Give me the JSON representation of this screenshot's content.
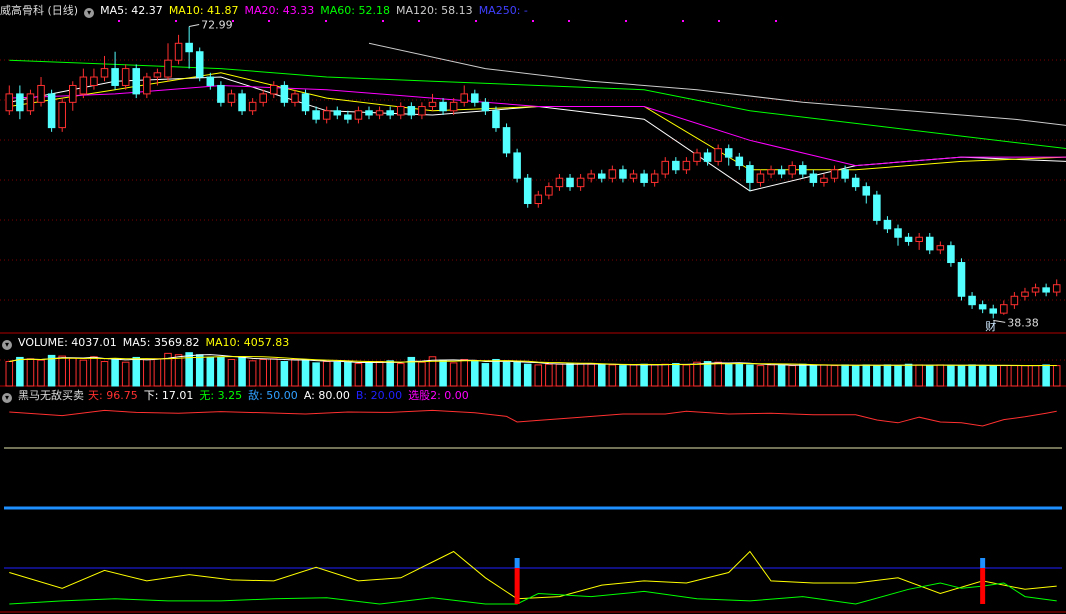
{
  "price_panel": {
    "title": "威高骨科 (日线)",
    "ma_labels": [
      {
        "text": "MA5: 42.37",
        "color": "#ffffff"
      },
      {
        "text": "MA10: 41.87",
        "color": "#ffff00"
      },
      {
        "text": "MA20: 43.33",
        "color": "#ff00ff"
      },
      {
        "text": "MA60: 52.18",
        "color": "#00ff00"
      },
      {
        "text": "MA120: 58.13",
        "color": "#cccccc"
      },
      {
        "text": "MA250: -",
        "color": "#4040ff"
      }
    ],
    "high_label": "72.99",
    "low_label": "38.38",
    "event_marker": "财"
  },
  "volume_panel": {
    "labels": [
      {
        "text": "VOLUME: 4037.01",
        "color": "#ffffff"
      },
      {
        "text": "MA5: 3569.82",
        "color": "#ffffff"
      },
      {
        "text": "MA10: 4057.83",
        "color": "#ffff00"
      }
    ]
  },
  "indicator_panel": {
    "title": "黑马无敌买卖",
    "labels": [
      {
        "text": "天: 96.75",
        "color": "#ff3030"
      },
      {
        "text": "下: 17.01",
        "color": "#ffffff"
      },
      {
        "text": "无: 3.25",
        "color": "#00ff00"
      },
      {
        "text": "敌: 50.00",
        "color": "#30a0ff"
      },
      {
        "text": "A: 80.00",
        "color": "#ffffff"
      },
      {
        "text": "B: 20.00",
        "color": "#2020ff"
      },
      {
        "text": "选股2: 0.00",
        "color": "#ff00ff"
      }
    ]
  },
  "colors": {
    "up": "#ff3030",
    "down": "#54ffff",
    "ma5": "#ffffff",
    "ma10": "#ffff00",
    "ma20": "#ff00ff",
    "ma60": "#00ff00",
    "ma120": "#cccccc",
    "frame": "#b00000",
    "grid": "#800000",
    "signal": "#ff0000"
  },
  "chart_data": [
    {
      "type": "candlestick",
      "ylim": [
        37,
        74
      ],
      "extrema": {
        "high": 72.99,
        "low": 38.38
      },
      "series": [
        {
          "name": "MA5",
          "x": [
            0,
            10,
            20,
            30,
            40,
            50,
            60,
            70,
            80,
            90,
            100,
            110,
            118
          ],
          "values": [
            64.0,
            66.5,
            67.0,
            63.0,
            62.5,
            63.5,
            62.0,
            53.5,
            56.5,
            57.5,
            57.0,
            46.5,
            41.6
          ]
        },
        {
          "name": "MA10",
          "x": [
            0,
            10,
            20,
            30,
            40,
            50,
            60,
            70,
            80,
            90,
            100,
            110,
            118
          ],
          "values": [
            63.5,
            65.5,
            67.5,
            64.5,
            63.0,
            63.5,
            63.5,
            56.0,
            56.0,
            57.0,
            57.5,
            48.5,
            41.9
          ]
        },
        {
          "name": "MA20",
          "x": [
            0,
            10,
            20,
            30,
            40,
            50,
            60,
            70,
            80,
            90,
            100,
            110,
            118
          ],
          "values": [
            64.5,
            65.0,
            66.0,
            65.5,
            64.5,
            63.5,
            63.5,
            59.5,
            56.5,
            57.5,
            57.5,
            53.5,
            43.3
          ]
        },
        {
          "name": "MA60",
          "x": [
            0,
            10,
            20,
            30,
            40,
            50,
            60,
            70,
            80,
            90,
            100,
            110,
            118
          ],
          "values": [
            69.0,
            68.5,
            68.0,
            67.0,
            66.5,
            66.0,
            65.5,
            63.0,
            61.5,
            60.0,
            58.5,
            55.5,
            52.2
          ]
        },
        {
          "name": "MA120",
          "x": [
            34,
            45,
            55,
            65,
            75,
            85,
            95,
            105,
            118
          ],
          "values": [
            71.0,
            68.0,
            66.5,
            65.5,
            64.0,
            63.0,
            62.0,
            60.5,
            58.1
          ]
        }
      ],
      "candles": [
        [
          0,
          63,
          65,
          62.5,
          66
        ],
        [
          1,
          65,
          63,
          62,
          66
        ],
        [
          2,
          63,
          65,
          62.5,
          65.5
        ],
        [
          3,
          64,
          66,
          63.5,
          67
        ],
        [
          4,
          65,
          61,
          60.5,
          65.5
        ],
        [
          5,
          61,
          64,
          60.5,
          64.5
        ],
        [
          6,
          64,
          66,
          63,
          66.5
        ],
        [
          7,
          65,
          67,
          64.5,
          68
        ],
        [
          8,
          66,
          67,
          65.5,
          68
        ],
        [
          9,
          67,
          68,
          66.5,
          69.5
        ],
        [
          10,
          68,
          66,
          65.5,
          70
        ],
        [
          11,
          66,
          68,
          65.5,
          68.5
        ],
        [
          12,
          68,
          65,
          64.5,
          68.5
        ],
        [
          13,
          65,
          67,
          64.5,
          67.5
        ],
        [
          14,
          67,
          67.5,
          66,
          68
        ],
        [
          15,
          67,
          69,
          66.5,
          71
        ],
        [
          16,
          69,
          71,
          68.5,
          72
        ],
        [
          17,
          71,
          70,
          68,
          72.99
        ],
        [
          18,
          70,
          67,
          66.5,
          70.5
        ],
        [
          19,
          67,
          66,
          65.5,
          67.5
        ],
        [
          20,
          66,
          64,
          63.5,
          66.5
        ],
        [
          21,
          64,
          65,
          63.5,
          65.5
        ],
        [
          22,
          65,
          63,
          62.5,
          65.5
        ],
        [
          23,
          63,
          64,
          62.5,
          64.5
        ],
        [
          24,
          64,
          65,
          63.5,
          65.5
        ],
        [
          25,
          65,
          66,
          64.5,
          66.5
        ],
        [
          26,
          66,
          64,
          63.5,
          66.5
        ],
        [
          27,
          64,
          65,
          63.5,
          65.5
        ],
        [
          28,
          65,
          63,
          62.5,
          65.5
        ],
        [
          29,
          63,
          62,
          61.5,
          63.5
        ],
        [
          30,
          62,
          63,
          61.5,
          63.5
        ],
        [
          31,
          63,
          62.5,
          62,
          63.5
        ],
        [
          32,
          62.5,
          62,
          61.5,
          63
        ],
        [
          33,
          62,
          63,
          61.5,
          63.5
        ],
        [
          34,
          63,
          62.5,
          62,
          63.5
        ],
        [
          35,
          62.5,
          63,
          62,
          63.5
        ],
        [
          36,
          63,
          62.5,
          62,
          63.5
        ],
        [
          37,
          62.5,
          63.5,
          62,
          64
        ],
        [
          38,
          63.5,
          62.5,
          62,
          64
        ],
        [
          39,
          62.5,
          63.5,
          62,
          64
        ],
        [
          40,
          63.5,
          64,
          63,
          65
        ],
        [
          41,
          64,
          63,
          62.5,
          64.5
        ],
        [
          42,
          63,
          64,
          62.5,
          64.5
        ],
        [
          43,
          64,
          65,
          63.5,
          66
        ],
        [
          44,
          65,
          64,
          63.5,
          65.5
        ],
        [
          45,
          64,
          63,
          62.5,
          64.5
        ],
        [
          46,
          63,
          61,
          60.5,
          63.5
        ],
        [
          47,
          61,
          58,
          57.5,
          61.5
        ],
        [
          48,
          58,
          55,
          54.5,
          58.5
        ],
        [
          49,
          55,
          52,
          51.5,
          55.5
        ],
        [
          50,
          52,
          53,
          51.5,
          53.5
        ],
        [
          51,
          53,
          54,
          52.5,
          54.5
        ],
        [
          52,
          54,
          55,
          53.5,
          55.5
        ],
        [
          53,
          55,
          54,
          53.5,
          55.5
        ],
        [
          54,
          54,
          55,
          53.5,
          55.5
        ],
        [
          55,
          55,
          55.5,
          54.5,
          56
        ],
        [
          56,
          55.5,
          55,
          54.5,
          56
        ],
        [
          57,
          55,
          56,
          54.5,
          56.5
        ],
        [
          58,
          56,
          55,
          54.5,
          56.5
        ],
        [
          59,
          55,
          55.5,
          54.5,
          56
        ],
        [
          60,
          55.5,
          54.5,
          54,
          56
        ],
        [
          61,
          54.5,
          55.5,
          54,
          56
        ],
        [
          62,
          55.5,
          57,
          55,
          57.5
        ],
        [
          63,
          57,
          56,
          55.5,
          57.5
        ],
        [
          64,
          56,
          57,
          55.5,
          57.5
        ],
        [
          65,
          57,
          58,
          56.5,
          58.5
        ],
        [
          66,
          58,
          57,
          56.5,
          58.5
        ],
        [
          67,
          57,
          58.5,
          56.5,
          59
        ],
        [
          68,
          58.5,
          57.5,
          56.5,
          59
        ],
        [
          69,
          57.5,
          56.5,
          56,
          58
        ],
        [
          70,
          56.5,
          54.5,
          53.5,
          57
        ],
        [
          71,
          54.5,
          55.5,
          54,
          56
        ],
        [
          72,
          55.5,
          56,
          55,
          56.5
        ],
        [
          73,
          56,
          55.5,
          55,
          56.5
        ],
        [
          74,
          55.5,
          56.5,
          55,
          57
        ],
        [
          75,
          56.5,
          55.5,
          55,
          57
        ],
        [
          76,
          55.5,
          54.5,
          54,
          56
        ],
        [
          77,
          54.5,
          55,
          54,
          55.5
        ],
        [
          78,
          55,
          56,
          54.5,
          56.5
        ],
        [
          79,
          56,
          55,
          54.5,
          56.5
        ],
        [
          80,
          55,
          54,
          53.5,
          55.5
        ],
        [
          81,
          54,
          53,
          52,
          54.5
        ],
        [
          82,
          53,
          50,
          49.5,
          53.5
        ],
        [
          83,
          50,
          49,
          48.5,
          50.5
        ],
        [
          84,
          49,
          48,
          47,
          49.5
        ],
        [
          85,
          48,
          47.5,
          47,
          48.5
        ],
        [
          86,
          47.5,
          48,
          46.5,
          48.5
        ],
        [
          87,
          48,
          46.5,
          46,
          48.5
        ],
        [
          88,
          46.5,
          47,
          46,
          47.5
        ],
        [
          89,
          47,
          45,
          44.5,
          47.5
        ],
        [
          90,
          45,
          41,
          40.5,
          45.5
        ],
        [
          91,
          41,
          40,
          39.5,
          41.5
        ],
        [
          92,
          40,
          39.5,
          39,
          40.5
        ],
        [
          93,
          39.5,
          39,
          38.38,
          40
        ],
        [
          94,
          39,
          40,
          38.8,
          40.5
        ],
        [
          95,
          40,
          41,
          39.5,
          41.5
        ],
        [
          96,
          41,
          41.5,
          40.5,
          42
        ],
        [
          97,
          41.5,
          42,
          41,
          42.5
        ],
        [
          98,
          42,
          41.5,
          41,
          42.5
        ],
        [
          99,
          41.5,
          42.37,
          41,
          43
        ]
      ]
    },
    {
      "type": "bar",
      "name": "VOLUME",
      "values": [
        3.6,
        4.2,
        4.0,
        3.8,
        4.5,
        4.4,
        4.1,
        3.8,
        4.3,
        3.6,
        4.0,
        3.5,
        4.2,
        3.9,
        4.0,
        4.8,
        4.6,
        4.9,
        4.6,
        4.2,
        4.2,
        3.9,
        4.3,
        3.7,
        3.9,
        4.0,
        3.6,
        3.9,
        3.8,
        3.4,
        3.6,
        3.5,
        3.5,
        3.3,
        3.4,
        3.6,
        3.7,
        3.3,
        4.2,
        3.5,
        4.3,
        3.8,
        3.4,
        3.9,
        3.6,
        3.3,
        3.9,
        3.5,
        3.5,
        3.2,
        3.1,
        3.2,
        3.2,
        3.3,
        3.3,
        3.2,
        3.1,
        3.1,
        3.0,
        3.1,
        3.2,
        3.1,
        3.2,
        3.3,
        3.1,
        3.5,
        3.6,
        3.5,
        3.2,
        3.3,
        3.1,
        3.0,
        3.1,
        3.1,
        3.0,
        3.2,
        3.0,
        3.1,
        3.0,
        3.1,
        3.0,
        3.1,
        3.0,
        3.1,
        3.0,
        3.2,
        3.1,
        3.0,
        3.1,
        3.0,
        3.0,
        3.1,
        3.0,
        3.0,
        3.0,
        3.0,
        3.0,
        3.0,
        3.1,
        3.0
      ]
    },
    {
      "type": "line",
      "name": "黑马无敌买卖",
      "series": [
        {
          "name": "天",
          "x": [
            0,
            5,
            9,
            12,
            16,
            20,
            24,
            28,
            32,
            36,
            40,
            44,
            47,
            48,
            50,
            54,
            58,
            62,
            64,
            68,
            72,
            76,
            80,
            82,
            84,
            86,
            88,
            90,
            92,
            94,
            96,
            98,
            99
          ],
          "values": [
            95,
            86,
            99,
            94,
            92,
            96,
            93,
            90,
            95,
            94,
            99,
            93,
            84,
            70,
            74,
            82,
            90,
            90,
            97,
            90,
            92,
            88,
            88,
            75,
            68,
            82,
            70,
            68,
            60,
            76,
            83,
            92,
            97
          ]
        },
        {
          "name": "下",
          "x": [
            0,
            5,
            9,
            13,
            17,
            21,
            25,
            29,
            33,
            37,
            40,
            42,
            45,
            48,
            52,
            56,
            60,
            64,
            68,
            70,
            72,
            76,
            80,
            84,
            88,
            92,
            96,
            99
          ],
          "values": [
            30,
            15,
            32,
            22,
            28,
            23,
            22,
            35,
            22,
            25,
            40,
            50,
            25,
            5,
            7,
            18,
            22,
            20,
            30,
            50,
            22,
            20,
            20,
            25,
            10,
            22,
            14,
            17
          ]
        },
        {
          "name": "无",
          "x": [
            0,
            5,
            10,
            15,
            20,
            25,
            30,
            35,
            40,
            45,
            48,
            50,
            55,
            60,
            65,
            70,
            75,
            80,
            85,
            88,
            90,
            92,
            94,
            96,
            99
          ],
          "values": [
            0,
            3,
            5,
            3,
            3,
            5,
            6,
            0,
            6,
            0,
            0,
            10,
            7,
            12,
            5,
            3,
            7,
            0,
            14,
            20,
            15,
            17,
            20,
            7,
            3
          ]
        }
      ],
      "signals": [
        48,
        92
      ],
      "reference_levels": [
        50
      ]
    }
  ]
}
